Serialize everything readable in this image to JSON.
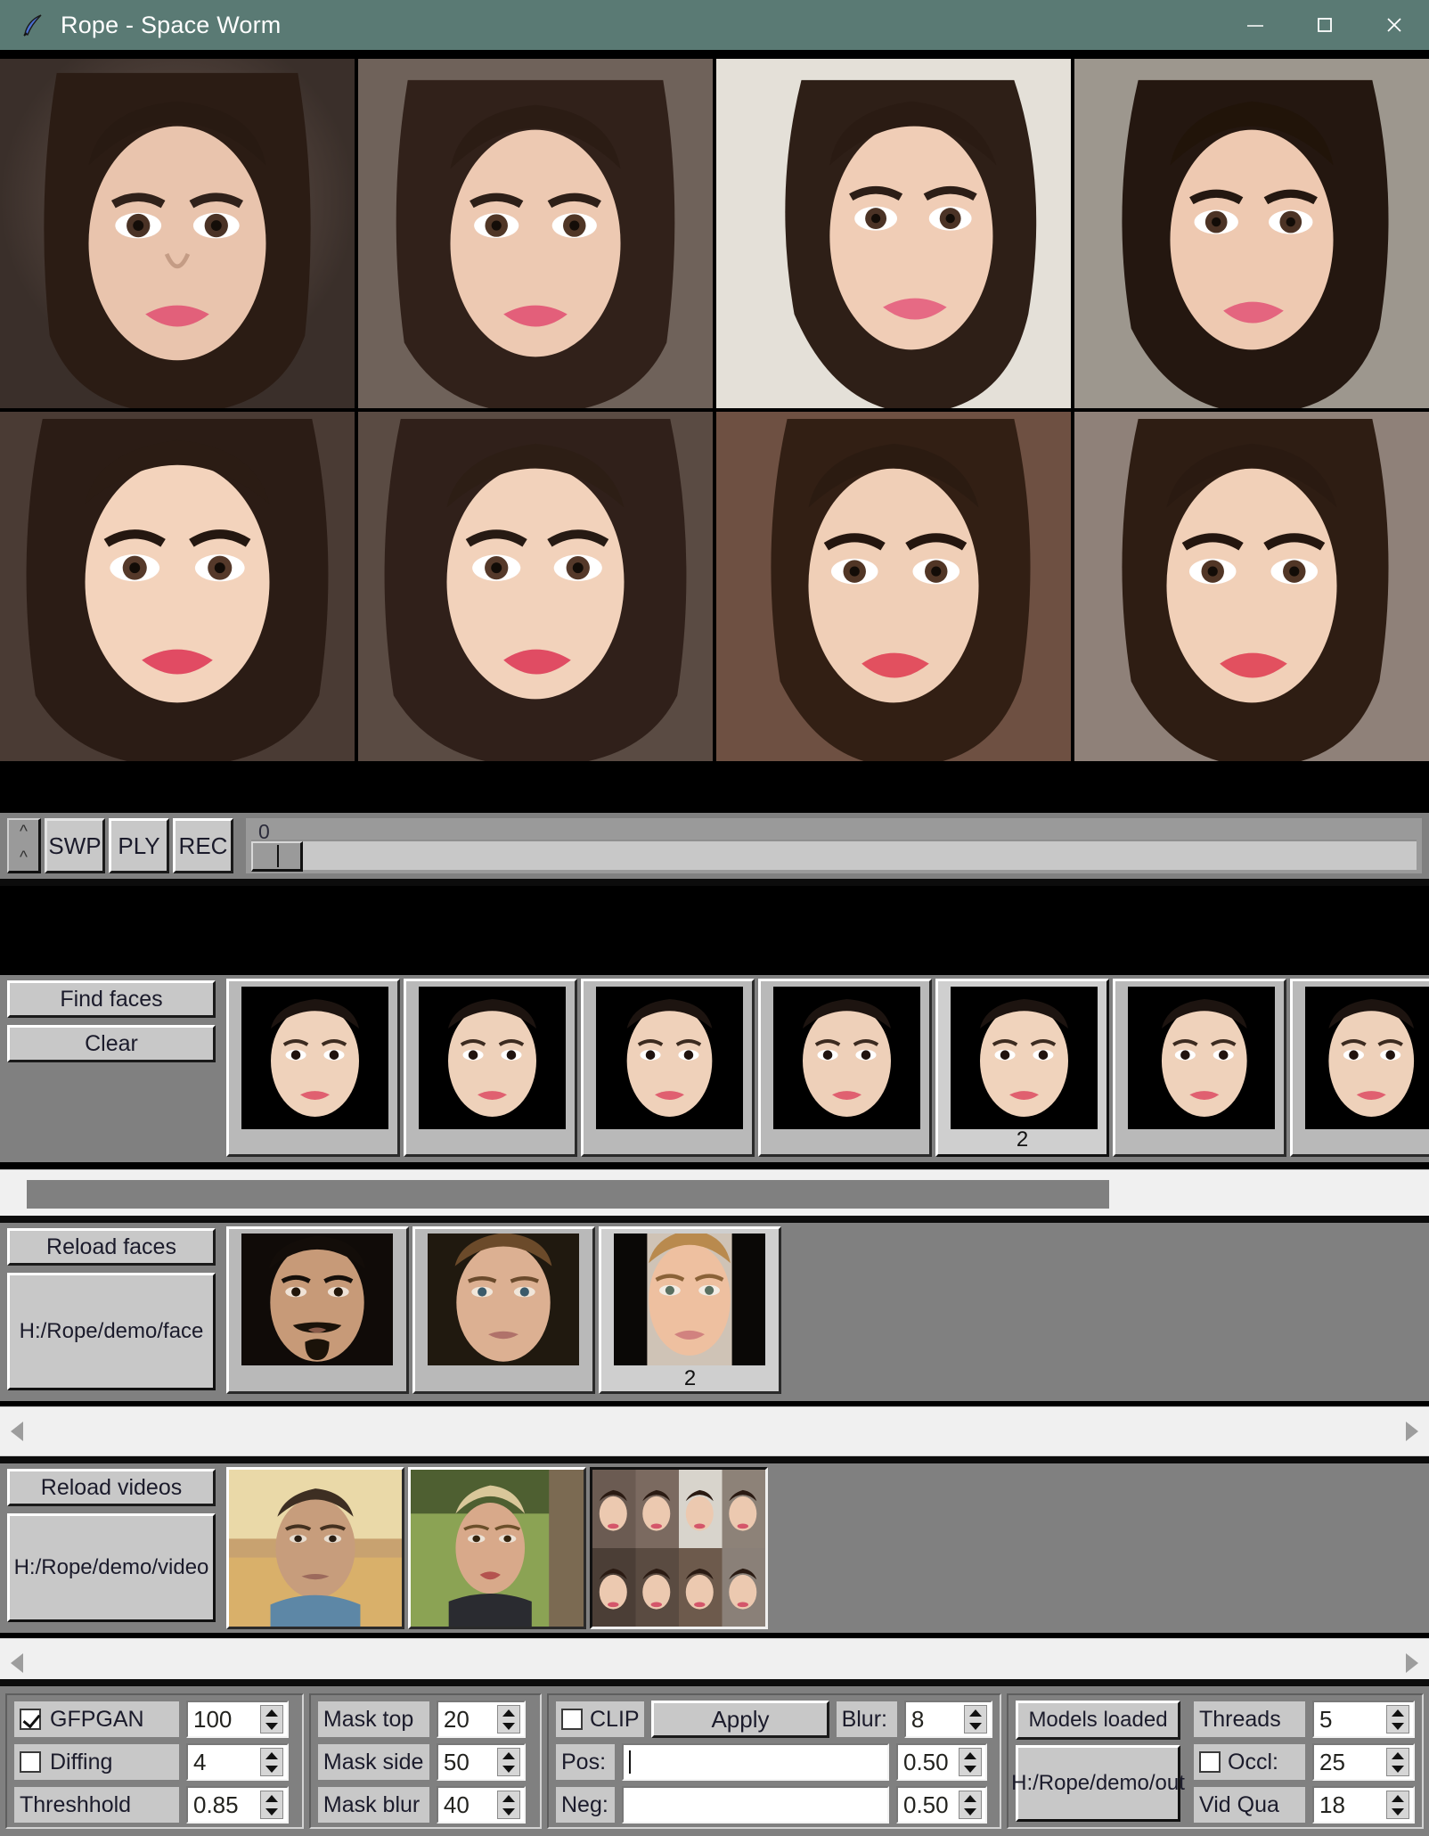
{
  "window": {
    "title": "Rope - Space Worm",
    "icon": "quill-feather-icon",
    "titlebar_color": "#5a7a74",
    "minimize": "–",
    "maximize": "□",
    "close": "✕"
  },
  "preview": {
    "row_count": 2,
    "col_count": 4,
    "cells": [
      {
        "id": "preview-1",
        "desc": "portrait front facing"
      },
      {
        "id": "preview-2",
        "desc": "portrait front facing"
      },
      {
        "id": "preview-3",
        "desc": "portrait three-quarter"
      },
      {
        "id": "preview-4",
        "desc": "portrait front facing"
      },
      {
        "id": "preview-5",
        "desc": "portrait front facing"
      },
      {
        "id": "preview-6",
        "desc": "portrait front facing"
      },
      {
        "id": "preview-7",
        "desc": "portrait front facing"
      },
      {
        "id": "preview-8",
        "desc": "portrait front facing"
      }
    ]
  },
  "transport": {
    "up_arrow": "^",
    "up_arrow2": "^",
    "swap_label": "SWP",
    "play_label": "PLY",
    "record_label": "REC",
    "frame_value": "0",
    "slider_position_pct": 0
  },
  "target_faces": {
    "find_faces_label": "Find faces",
    "clear_label": "Clear",
    "selected_index": 4,
    "thumbs": [
      {
        "caption": ""
      },
      {
        "caption": ""
      },
      {
        "caption": ""
      },
      {
        "caption": ""
      },
      {
        "caption": "2"
      },
      {
        "caption": ""
      },
      {
        "caption": ""
      }
    ],
    "scrollbar_thumb_pct": 78
  },
  "source_faces": {
    "reload_label": "Reload faces",
    "path": "H:/Rope/demo/face",
    "selected_index": 2,
    "thumbs": [
      {
        "caption": "",
        "desc": "man with moustache and goatee"
      },
      {
        "caption": "",
        "desc": "clean shaven blond man"
      },
      {
        "caption": "2",
        "desc": "blonde woman"
      }
    ],
    "scrollbar_thumb_pct": 0
  },
  "videos": {
    "reload_label": "Reload videos",
    "path": "H:/Rope/demo/video",
    "selected_index": 2,
    "thumbs": [
      {
        "desc": "man at sunset on boat"
      },
      {
        "desc": "woman outdoors in field"
      },
      {
        "desc": "grid of eight portraits"
      }
    ],
    "scrollbar_thumb_pct": 0
  },
  "controls": {
    "group1": {
      "gfpgan": {
        "label": "GFPGAN",
        "checked": true,
        "value": "100"
      },
      "diffing": {
        "label": "Diffing",
        "checked": false,
        "value": "4"
      },
      "threshhold": {
        "label": "Threshhold",
        "value": "0.85"
      }
    },
    "group2": {
      "mask_top": {
        "label": "Mask top",
        "value": "20"
      },
      "mask_side": {
        "label": "Mask side",
        "value": "50"
      },
      "mask_blur": {
        "label": "Mask blur",
        "value": "40"
      }
    },
    "group3": {
      "clip": {
        "label": "CLIP",
        "checked": false
      },
      "apply_label": "Apply",
      "blur": {
        "label": "Blur:",
        "value": "8"
      },
      "pos": {
        "label": "Pos:",
        "value": "",
        "strength": "0.50"
      },
      "neg": {
        "label": "Neg:",
        "value": "",
        "strength": "0.50"
      }
    },
    "group4": {
      "models_label": "Models loaded",
      "output_path": "H:/Rope/demo/out",
      "threads": {
        "label": "Threads",
        "value": "5"
      },
      "occl": {
        "label": "Occl:",
        "checked": false,
        "value": "25"
      },
      "vid_qua": {
        "label": "Vid Qua",
        "value": "18"
      }
    }
  }
}
